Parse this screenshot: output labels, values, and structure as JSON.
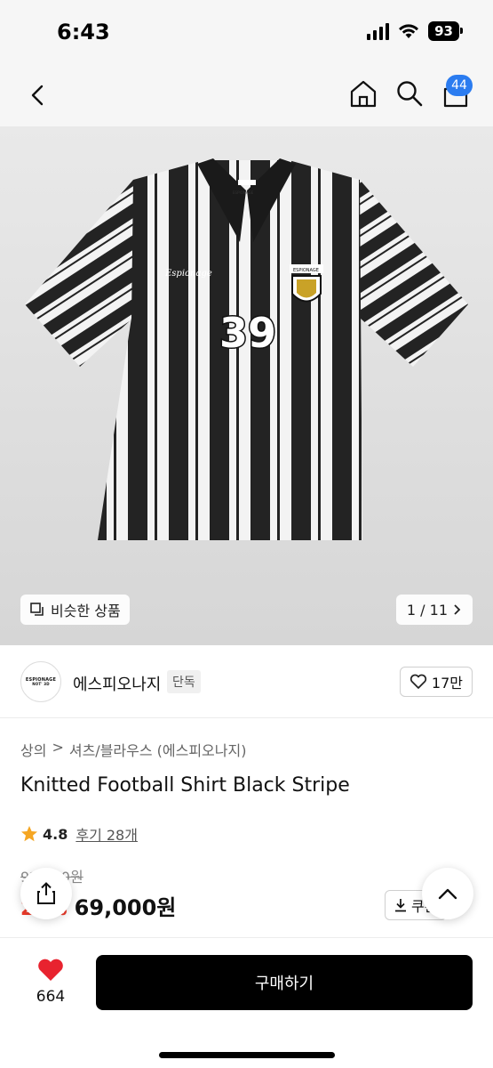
{
  "status_bar": {
    "time": "6:43",
    "battery": "93"
  },
  "nav": {
    "cart_count": "44"
  },
  "gallery": {
    "similar_label": "비슷한 상품",
    "page_indicator": "1 / 11",
    "shirt_number": "39",
    "shirt_script": "Espionage",
    "badge_text": "ESPIONAGE",
    "collar_label": "ESPIONAGE"
  },
  "brand": {
    "logo_text": "ESPIONAGE",
    "logo_subtext": "NOT' 3D",
    "name": "에스피오나지",
    "badge": "단독",
    "like_count": "17만"
  },
  "product": {
    "breadcrumb": [
      "상의",
      "셔츠/블라우스 (에스피오나지)"
    ],
    "title": "Knitted Football Shirt Black Stripe",
    "rating": "4.8",
    "review_label": "후기 28개",
    "original_price": "92,000원",
    "discount_rate": "25%",
    "sale_price": "69,000원",
    "coupon_label": "쿠폰"
  },
  "bottom_bar": {
    "like_count": "664",
    "buy_label": "구매하기"
  },
  "colors": {
    "accent_blue": "#2b7cf0",
    "discount_red": "#ee3b2b",
    "heart_red": "#e8232f",
    "star_orange": "#f5a623"
  }
}
